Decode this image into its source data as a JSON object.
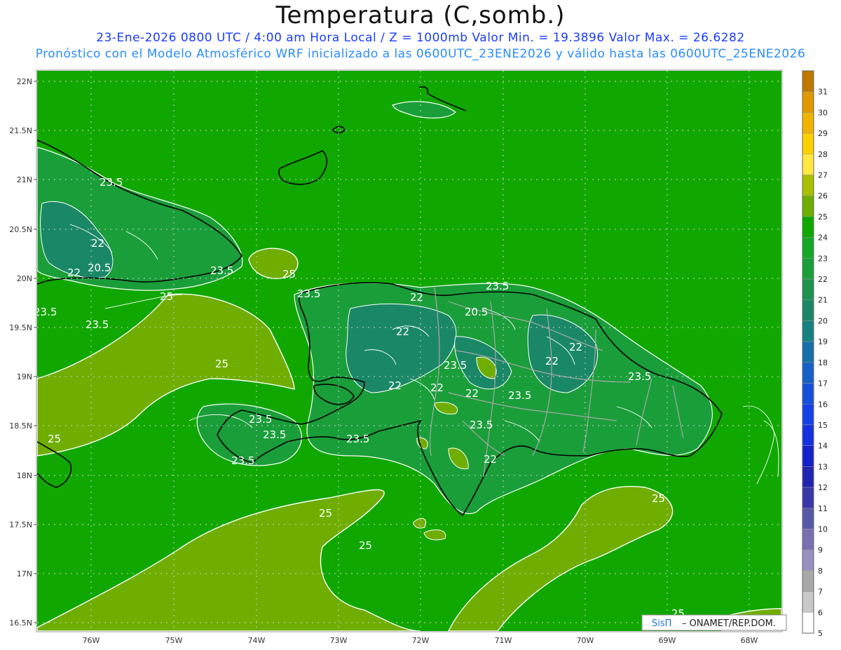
{
  "header": {
    "title": "Temperatura (C,somb.)",
    "line1": "23-Ene-2026  0800 UTC / 4:00 am Hora Local / Z = 1000mb   Valor Min. = 19.3896  Valor Max. = 26.6282",
    "line2": "Pronóstico con el Modelo Atmosférico WRF inicializado a las 0600UTC_23ENE2026 y válido hasta las  0600UTC_25ENE2026"
  },
  "axes": {
    "lat_labels": [
      "22N",
      "21.5N",
      "21N",
      "20.5N",
      "20N",
      "19.5N",
      "19N",
      "18.5N",
      "18N",
      "17.5N",
      "17N",
      "16.5N"
    ],
    "lon_labels": [
      "76W",
      "75W",
      "74W",
      "73W",
      "72W",
      "71W",
      "70W",
      "69W",
      "68W"
    ]
  },
  "contour_labels": [
    "23.5",
    "22",
    "20.5",
    "23.5",
    "25",
    "23.5",
    "25",
    "23.5",
    "22",
    "20.5",
    "22",
    "22",
    "23.5",
    "22",
    "22",
    "22",
    "23.5",
    "22",
    "23.5",
    "23.5",
    "23.5",
    "23.5",
    "23.5",
    "23.5",
    "23.5",
    "25",
    "25",
    "25",
    "25",
    "25",
    "25",
    "22",
    "22",
    "23.5"
  ],
  "colorbar": {
    "labels": [
      "31",
      "30",
      "29",
      "28",
      "27",
      "26",
      "25",
      "24",
      "23",
      "22",
      "21",
      "20",
      "19",
      "18",
      "17",
      "16",
      "15",
      "14",
      "13",
      "12",
      "11",
      "10",
      "9",
      "8",
      "7",
      "6",
      "5"
    ],
    "colors": [
      "#c07800",
      "#e09800",
      "#f0b400",
      "#ffd000",
      "#ffe840",
      "#a8c000",
      "#6fae00",
      "#10a800",
      "#14a824",
      "#1a9e3a",
      "#1c9250",
      "#1a8866",
      "#178080",
      "#1470a8",
      "#1460c8",
      "#1450dc",
      "#1440e8",
      "#1430e0",
      "#1420c8",
      "#2024b0",
      "#3838a8",
      "#5858a8",
      "#7870b0",
      "#9890c0",
      "#a8a8a8",
      "#c8c8c8",
      "#ffffff"
    ]
  },
  "credit": {
    "brand": "SisΠ",
    "rest": "– ONAMET/REP.DOM."
  }
}
